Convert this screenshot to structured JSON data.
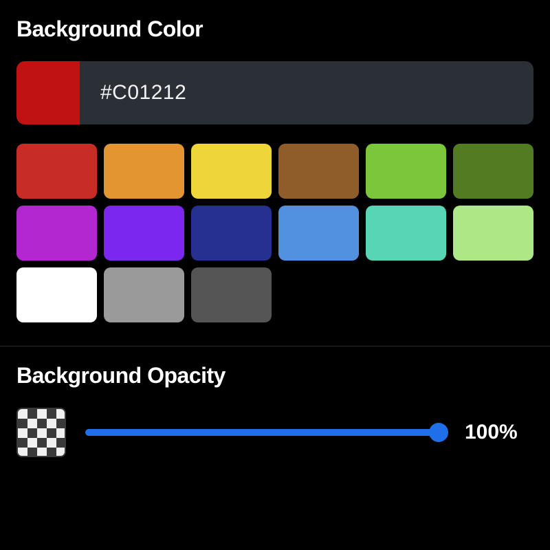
{
  "color_section": {
    "title": "Background Color",
    "current_color": "#C01212",
    "hex_value": "#C01212",
    "swatches": [
      "#C72D26",
      "#E29531",
      "#EED539",
      "#8E5D2A",
      "#7BC63A",
      "#527C22",
      "#B227D0",
      "#7B27EE",
      "#26308F",
      "#5191DE",
      "#57D5B5",
      "#ADE786",
      "#FFFFFF",
      "#9A9A9A",
      "#555555"
    ]
  },
  "opacity_section": {
    "title": "Background Opacity",
    "value_percent": 100,
    "value_label": "100%",
    "slider_color": "#1f6fea"
  }
}
